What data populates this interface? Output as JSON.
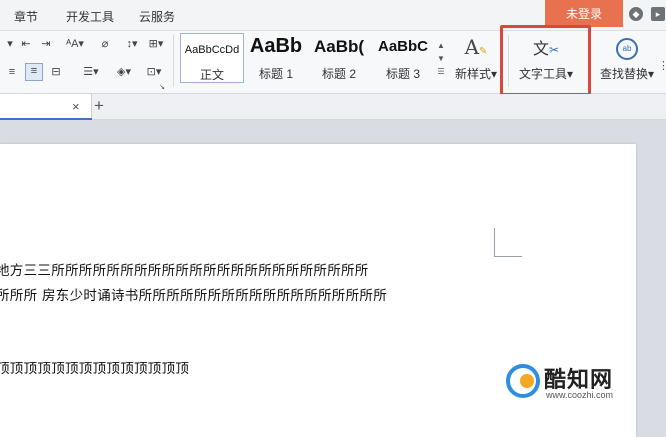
{
  "menubar": {
    "items": [
      "章节",
      "开发工具",
      "云服务"
    ],
    "login": "未登录"
  },
  "ribbon": {
    "styles": [
      {
        "sample": "AaBbCcDd",
        "label": "正文"
      },
      {
        "sample": "AaBb",
        "label": "标题 1"
      },
      {
        "sample": "AaBb(",
        "label": "标题 2"
      },
      {
        "sample": "AaBbC",
        "label": "标题 3"
      }
    ],
    "new_style": "新样式",
    "text_tools": "文字工具",
    "find_replace": "查找替换"
  },
  "tabs": {
    "close": "×",
    "add": "+"
  },
  "document": {
    "lines": [
      "  地方三三所所所所所所所所所所所所所所所所所所所所所所所",
      "所所所  房东少时诵诗书所所所所所所所所所所所所所所所所所所",
      "顶顶顶顶顶顶顶顶顶顶顶顶顶顶"
    ]
  },
  "watermark": {
    "name": "酷知网",
    "url": "www.coozhi.com"
  },
  "colors": {
    "login_bg": "#e8724f",
    "highlight": "#d9473f",
    "tab_accent": "#3b74c9"
  }
}
